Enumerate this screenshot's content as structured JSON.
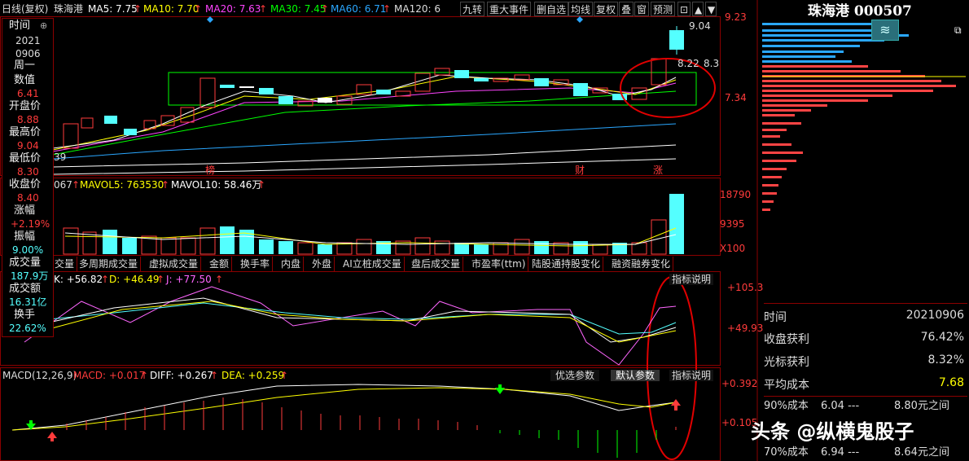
{
  "header": {
    "period": "日线(复权)",
    "stock_name": "珠海港",
    "ma5": "MA5: 7.75",
    "ma10": "MA10: 7.70",
    "ma20": "MA20: 7.63",
    "ma30": "MA30: 7.45",
    "ma60": "MA60: 6.71",
    "ma120": "MA120: 6"
  },
  "toolbar": [
    "九转",
    "重大事件",
    "删自选",
    "均线",
    "复权",
    "叠",
    "窗",
    "预测"
  ],
  "price_axis": {
    "high": "9.23",
    "low": "7.34",
    "last_high": "9.04",
    "last_mid": "8.22",
    "last_mid2": "8.3",
    "left_low": "39"
  },
  "chart_markers": {
    "m1": "榜",
    "m2": "财",
    "m3": "涨"
  },
  "volume": {
    "mavol_prefix": "067",
    "mavol5": "MAVOL5: 763530",
    "mavol10": "MAVOL10: 58.46万",
    "axis_top": "18790",
    "axis_mid": "9395",
    "axis_unit": "X100"
  },
  "tabs": [
    "交量",
    "多周期成交量",
    "虚拟成交量",
    "金额",
    "换手率",
    "内盘",
    "外盘",
    "AI立桩成交量",
    "盘后成交量",
    "市盈率(ttm)",
    "陆股通持股变化",
    "融资融券变化"
  ],
  "kdj": {
    "k": "K: +56.82",
    "d": "D: +46.49",
    "j": "J: +77.50",
    "axis_top": "+105.3",
    "axis_mid": "+49.93",
    "explain": "指标说明"
  },
  "macd": {
    "title": "MACD(12,26,9)",
    "macd": "MACD: +0.017",
    "diff": "DIFF: +0.267",
    "dea": "DEA: +0.259",
    "axis_top": "+0.392",
    "axis_mid": "+0.105",
    "btn_opt": "优选参数",
    "btn_default": "默认参数",
    "explain": "指标说明"
  },
  "info_panel": {
    "time_label": "时间",
    "year": "2021",
    "date": "0906",
    "weekday": "周一",
    "value_label": "数值",
    "value": "6.41",
    "open_label": "开盘价",
    "open": "8.88",
    "high_label": "最高价",
    "high": "9.04",
    "low_label": "最低价",
    "low": "8.30",
    "close_label": "收盘价",
    "close": "8.40",
    "chg_label": "涨幅",
    "chg": "+2.19%",
    "amp_label": "振幅",
    "amp": "9.00%",
    "vol_label": "成交量",
    "vol": "187.9万",
    "amt_label": "成交额",
    "amt": "16.31亿",
    "turn_label": "换手",
    "turn": "22.62%"
  },
  "right_panel": {
    "title": "珠海港 000507",
    "rows": [
      {
        "label": "时间",
        "value": "20210906"
      },
      {
        "label": "收盘获利",
        "value": "76.42%"
      },
      {
        "label": "光标获利",
        "value": "8.32%"
      },
      {
        "label": "平均成本",
        "value": "7.68"
      }
    ],
    "cost90": {
      "label": "90%成本",
      "a": "6.04 ---",
      "b": "8.80元之间"
    },
    "cost70": {
      "label": "70%成本",
      "a": "6.94 ---",
      "b": "8.64元之间"
    }
  },
  "watermark": "头条 @纵横鬼股子",
  "colors": {
    "up": "#ff3b3b",
    "down": "#54ffff",
    "ma5": "#ffffff",
    "ma10": "#ffff00",
    "ma20": "#ff00ff",
    "ma30": "#00ff00",
    "ma60": "#2aa7ff",
    "border": "#8b0000"
  }
}
